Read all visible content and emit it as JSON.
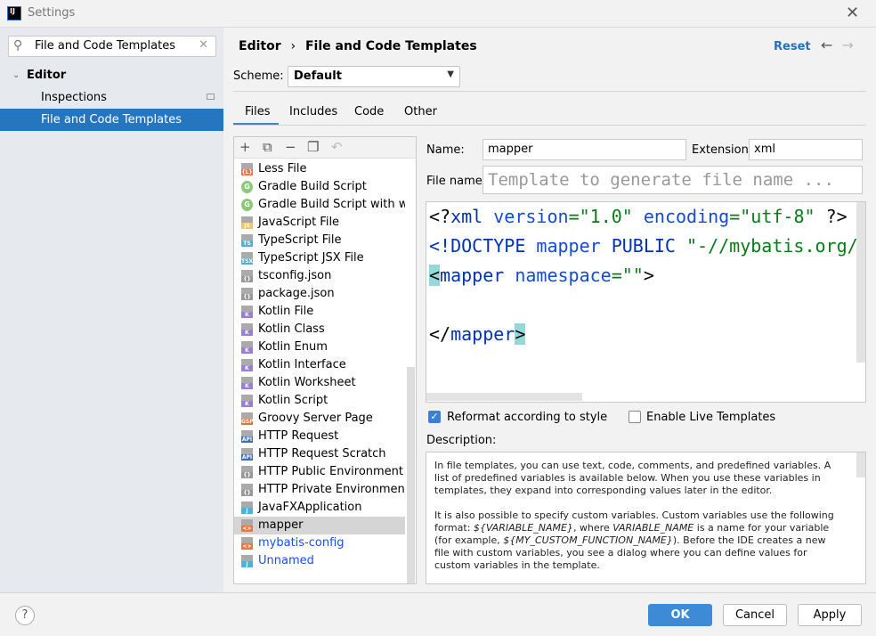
{
  "window": {
    "title": "Settings",
    "logo": "IJ"
  },
  "sidebar": {
    "search_value": "File and Code Templates",
    "tree": [
      {
        "label": "Editor",
        "expanded": true
      },
      {
        "label": "Inspections"
      },
      {
        "label": "File and Code Templates",
        "selected": true
      }
    ]
  },
  "header": {
    "breadcrumb_parent": "Editor",
    "breadcrumb_sep": "›",
    "breadcrumb_current": "File and Code Templates",
    "reset": "Reset"
  },
  "scheme": {
    "label": "Scheme:",
    "value": "Default"
  },
  "tabs": [
    {
      "label": "Files",
      "active": true
    },
    {
      "label": "Includes"
    },
    {
      "label": "Code"
    },
    {
      "label": "Other"
    }
  ],
  "templates": [
    {
      "label": "Less File",
      "icon": "less-file-icon",
      "badge": "{L}",
      "color": "#e07a4a"
    },
    {
      "label": "Gradle Build Script",
      "icon": "gradle-icon",
      "badge": "G",
      "color": "#8cc97b"
    },
    {
      "label": "Gradle Build Script with wrapper",
      "icon": "gradle-icon",
      "badge": "G",
      "color": "#8cc97b"
    },
    {
      "label": "JavaScript File",
      "icon": "javascript-file-icon",
      "badge": "JS",
      "color": "#f4c46a"
    },
    {
      "label": "TypeScript File",
      "icon": "typescript-file-icon",
      "badge": "TS",
      "color": "#4fb1d9"
    },
    {
      "label": "TypeScript JSX File",
      "icon": "tsx-file-icon",
      "badge": "TSX",
      "color": "#4fb1d9"
    },
    {
      "label": "tsconfig.json",
      "icon": "json-file-icon",
      "badge": "{}",
      "color": "#999999"
    },
    {
      "label": "package.json",
      "icon": "json-file-icon",
      "badge": "{}",
      "color": "#999999"
    },
    {
      "label": "Kotlin File",
      "icon": "kotlin-file-icon",
      "badge": "K",
      "color": "#9b7ed6"
    },
    {
      "label": "Kotlin Class",
      "icon": "kotlin-file-icon",
      "badge": "K",
      "color": "#9b7ed6"
    },
    {
      "label": "Kotlin Enum",
      "icon": "kotlin-file-icon",
      "badge": "K",
      "color": "#9b7ed6"
    },
    {
      "label": "Kotlin Interface",
      "icon": "kotlin-file-icon",
      "badge": "K",
      "color": "#9b7ed6"
    },
    {
      "label": "Kotlin Worksheet",
      "icon": "kotlin-file-icon",
      "badge": "K",
      "color": "#9b7ed6"
    },
    {
      "label": "Kotlin Script",
      "icon": "kotlin-file-icon",
      "badge": "K",
      "color": "#9b7ed6"
    },
    {
      "label": "Groovy Server Page",
      "icon": "gsp-file-icon",
      "badge": "GSP",
      "color": "#d9773b"
    },
    {
      "label": "HTTP Request",
      "icon": "http-request-icon",
      "badge": "API",
      "color": "#3d6fb5"
    },
    {
      "label": "HTTP Request Scratch",
      "icon": "http-request-icon",
      "badge": "API",
      "color": "#3d6fb5"
    },
    {
      "label": "HTTP Public Environment File",
      "icon": "json-file-icon",
      "badge": "{}",
      "color": "#999999"
    },
    {
      "label": "HTTP Private Environment File",
      "icon": "json-file-icon",
      "badge": "{}",
      "color": "#999999"
    },
    {
      "label": "JavaFXApplication",
      "icon": "java-file-icon",
      "badge": "J",
      "color": "#4fb1d9"
    },
    {
      "label": "mapper",
      "icon": "xml-file-icon",
      "badge": "<>",
      "color": "#e07a4a",
      "selected": true
    },
    {
      "label": "mybatis-config",
      "icon": "xml-file-icon",
      "badge": "<>",
      "color": "#e07a4a",
      "modified": true
    },
    {
      "label": "Unnamed",
      "icon": "java-file-icon",
      "badge": "J",
      "color": "#4fb1d9",
      "modified": true
    }
  ],
  "form": {
    "name_label": "Name:",
    "name_value": "mapper",
    "ext_label": "Extension:",
    "ext_value": "xml",
    "filename_label": "File name:",
    "filename_placeholder": "Template to generate file name ..."
  },
  "code": {
    "l1": {
      "a": "<?",
      "b": "xml ",
      "c": "version",
      "d": "=",
      "e": "\"1.0\"",
      "f": " encoding",
      "g": "=",
      "h": "\"utf-8\"",
      "i": " ?>"
    },
    "l2": {
      "a": "<!DOCTYPE ",
      "b": "mapper ",
      "c": "PUBLIC ",
      "d": "\"-//mybatis.org//"
    },
    "l3": {
      "a": "<",
      "b": "mapper ",
      "c": "namespace",
      "d": "=",
      "e": "\"\"",
      "f": ">"
    },
    "l5": {
      "a": "</",
      "b": "mapper",
      "c": ">"
    }
  },
  "options": {
    "reformat": "Reformat according to style",
    "reformat_checked": true,
    "live": "Enable Live Templates",
    "live_checked": false
  },
  "description": {
    "label": "Description:",
    "p1": "In file templates, you can use text, code, comments, and predefined variables. A list of predefined variables is available below. When you use these variables in templates, they expand into corresponding values later in the editor.",
    "p2a": "It is also possible to specify custom variables. Custom variables use the following format: ",
    "v1": "${VARIABLE_NAME}",
    "p2b": ", where ",
    "v2": "VARIABLE_NAME",
    "p2c": " is a name for your variable (for example, ",
    "v3": "${MY_CUSTOM_FUNCTION_NAME}",
    "p2d": "). Before the IDE creates a new file with custom variables, you see a dialog where you can define values for custom variables in the template."
  },
  "footer": {
    "help": "?",
    "ok": "OK",
    "cancel": "Cancel",
    "apply": "Apply"
  }
}
